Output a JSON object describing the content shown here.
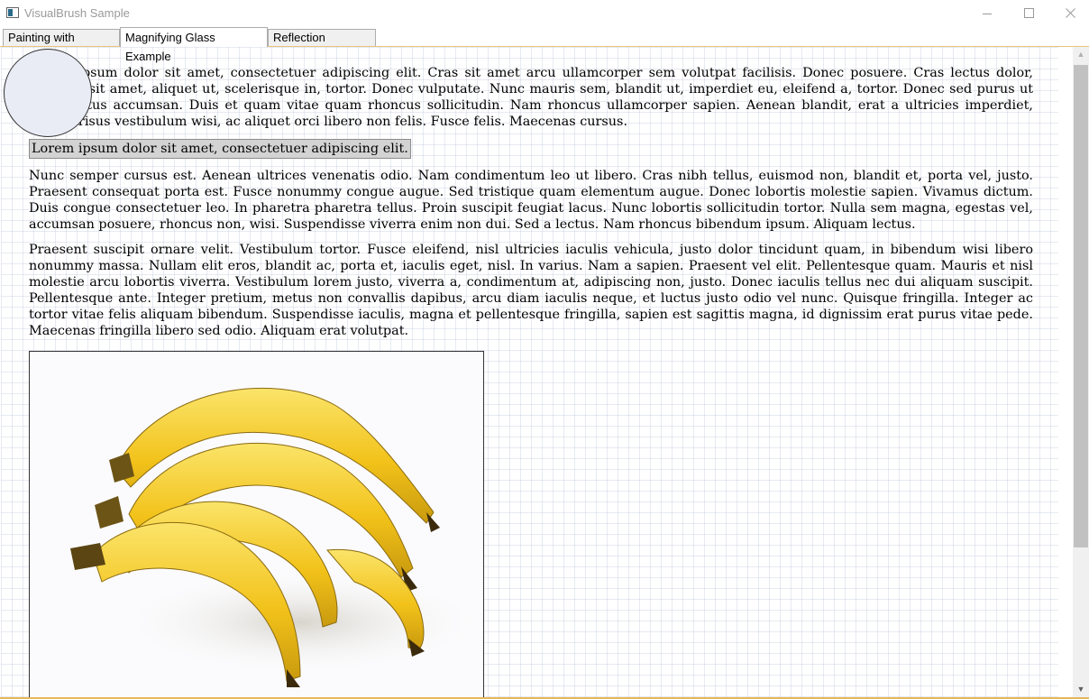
{
  "window": {
    "title": "VisualBrush Sample",
    "controls": {
      "minimize": "minimize",
      "maximize": "maximize",
      "close": "close"
    }
  },
  "tabs": [
    {
      "label": "Painting with Visuals",
      "active": false
    },
    {
      "label": "Magnifying Glass Example",
      "active": true
    },
    {
      "label": "Reflection Example",
      "active": false
    }
  ],
  "document": {
    "paragraph1": "Lorem ipsum dolor sit amet, consectetuer adipiscing elit. Cras sit amet arcu ullamcorper sem volutpat facilisis. Donec posuere. Cras lectus dolor, euismod sit amet, aliquet ut, scelerisque in, tortor. Donec vulputate. Nunc mauris sem, blandit ut, imperdiet eu, eleifend a, tortor. Donec sed purus ut pede luctus accumsan. Duis et quam vitae quam rhoncus sollicitudin. Nam rhoncus ullamcorper sapien. Aenean blandit, erat a ultricies imperdiet, mauris risus vestibulum wisi, ac aliquet orci libero non felis. Fusce felis. Maecenas cursus.",
    "highlight": "Lorem ipsum dolor sit amet, consectetuer adipiscing elit.",
    "paragraph2": "Nunc semper cursus est. Aenean ultrices venenatis odio. Nam condimentum leo ut libero. Cras nibh tellus, euismod non, blandit et, porta vel, justo. Praesent consequat porta est. Fusce nonummy congue augue. Sed tristique quam elementum augue. Donec lobortis molestie sapien. Vivamus dictum. Duis congue consectetuer leo. In pharetra pharetra tellus. Proin suscipit feugiat lacus. Nunc lobortis sollicitudin tortor. Nulla sem magna, egestas vel, accumsan posuere, rhoncus non, wisi. Suspendisse viverra enim non dui. Sed a lectus. Nam rhoncus bibendum ipsum. Aliquam lectus.",
    "paragraph3": "Praesent suscipit ornare velit. Vestibulum tortor. Fusce eleifend, nisl ultricies iaculis vehicula, justo dolor tincidunt quam, in bibendum wisi libero nonummy massa. Nullam elit eros, blandit ac, porta et, iaculis eget, nisl. In varius. Nam a sapien. Praesent vel elit. Pellentesque quam. Mauris et nisl molestie arcu lobortis viverra. Vestibulum lorem justo, viverra a, condimentum at, adipiscing non, justo. Donec iaculis tellus nec dui aliquam suscipit. Pellentesque ante. Integer pretium, metus non convallis dapibus, arcu diam iaculis neque, et luctus justo odio vel nunc. Quisque fringilla. Integer ac tortor vitae felis aliquam bibendum. Suspendisse iaculis, magna et pellentesque fringilla, sapien est sagittis magna, id dignissim erat purus vitae pede. Maecenas fringilla libero sed odio. Aliquam erat volutpat.",
    "image": "bananas"
  },
  "colors": {
    "grid": "#b4bcd6",
    "magnifier_fill": "#e9ebf5",
    "highlight_bg": "#d3d3d3",
    "banana_yellow": "#f2c21a",
    "banana_tip": "#4a3510",
    "accent": "#e6b75a"
  },
  "scrollbar": {
    "up_icon": "chevron-up-icon",
    "down_icon": "chevron-down-icon"
  }
}
